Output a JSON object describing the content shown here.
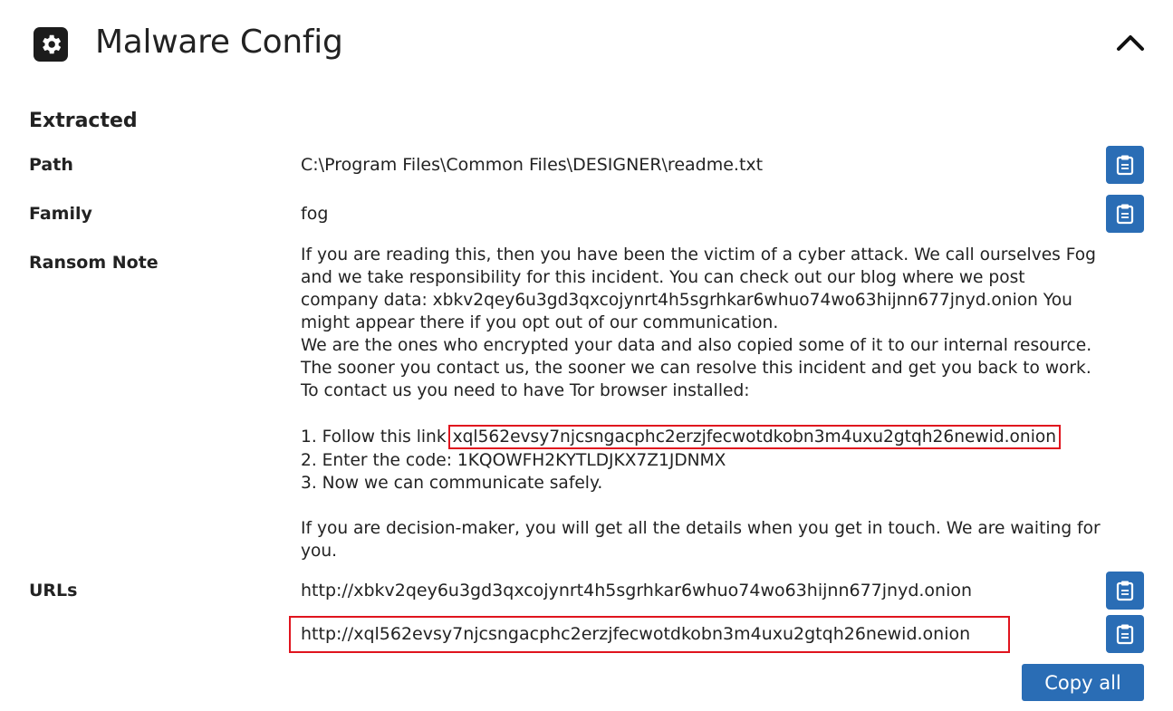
{
  "header": {
    "title": "Malware Config",
    "icon": "gear-icon",
    "collapse_icon": "chevron-up-icon"
  },
  "section": {
    "heading": "Extracted"
  },
  "fields": {
    "path": {
      "label": "Path",
      "value": "C:\\Program Files\\Common Files\\DESIGNER\\readme.txt"
    },
    "family": {
      "label": "Family",
      "value": "fog"
    },
    "ransom_note": {
      "label": "Ransom Note",
      "lines": [
        "If you are reading this, then you have been the victim of a cyber attack. We call ourselves Fog",
        "and we take responsibility for this incident. You can check out our blog where we post",
        "company data: xbkv2qey6u3gd3qxcojynrt4h5sgrhkar6whuo74wo63hijnn677jnyd.onion You",
        "might appear there if you opt out of our communication.",
        "We are the ones who encrypted your data and also copied some of it to our internal resource.",
        "The sooner you contact us, the sooner we can resolve this incident and get you back to work.",
        "To contact us you need to have Tor browser installed:"
      ],
      "step1_prefix": "1. Follow this link",
      "step1_link": "xql562evsy7njcsngacphc2erzjfecwotdkobn3m4uxu2gtqh26newid.onion",
      "step2": "2. Enter the code: 1KQOWFH2KYTLDJKX7Z1JDNMX",
      "step3": "3. Now we can communicate safely.",
      "closing_line1": "If you are decision-maker, you will get all the details when you get in touch. We are waiting for",
      "closing_line2": "you."
    },
    "urls": {
      "label": "URLs",
      "values": [
        "http://xbkv2qey6u3gd3qxcojynrt4h5sgrhkar6whuo74wo63hijnn677jnyd.onion",
        "http://xql562evsy7njcsngacphc2erzjfecwotdkobn3m4uxu2gtqh26newid.onion"
      ]
    }
  },
  "actions": {
    "copy_icon": "clipboard-icon",
    "copy_all_label": "Copy all"
  },
  "colors": {
    "accent": "#2a6db5",
    "highlight": "#e0141e",
    "text": "#222222"
  }
}
